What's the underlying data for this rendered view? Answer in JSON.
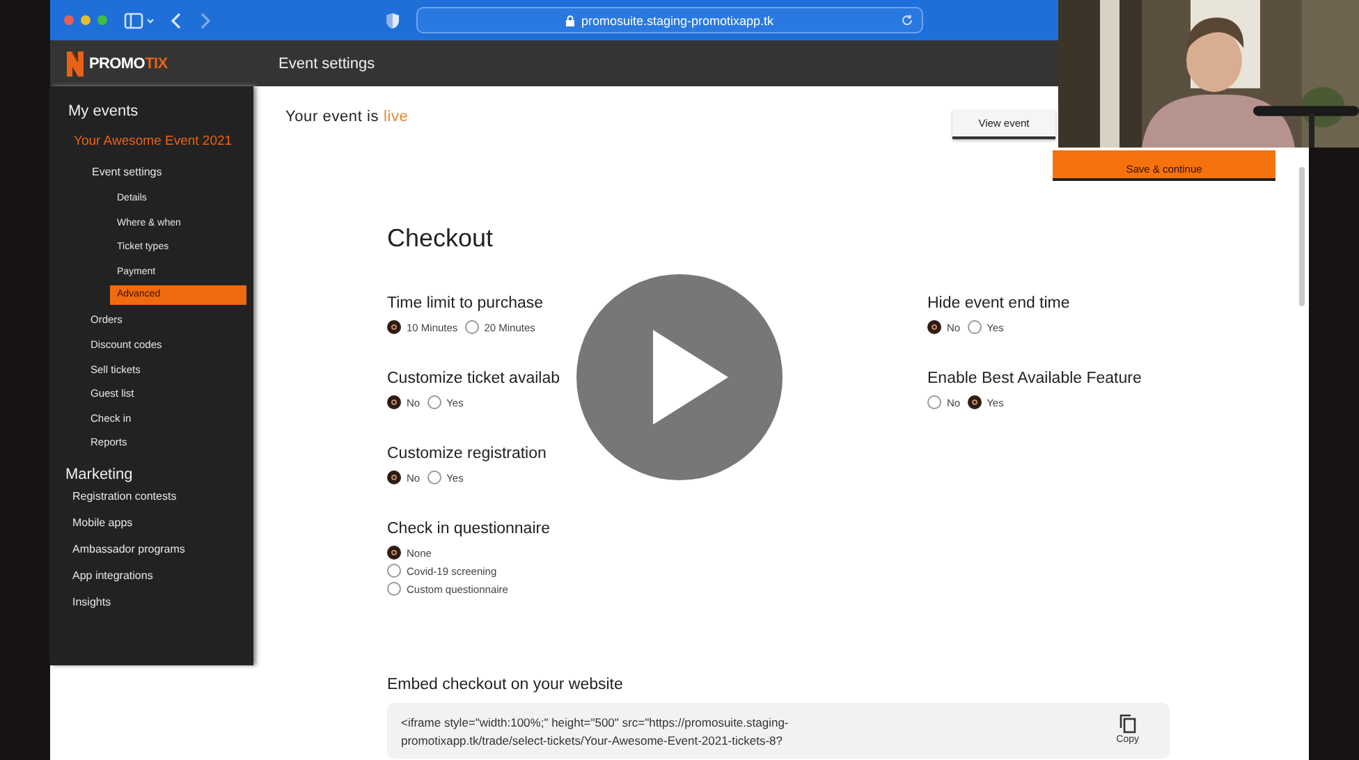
{
  "browser": {
    "url": "promosuite.staging-promotixapp.tk"
  },
  "app": {
    "logo_left": "PROMO",
    "logo_right": "TIX",
    "title": "Event settings"
  },
  "sidebar": {
    "heading": "My events",
    "event_name": "Your Awesome Event 2021",
    "items": [
      {
        "label": "Event settings",
        "selected": false,
        "children": [
          {
            "label": "Details",
            "selected": false
          },
          {
            "label": "Where & when",
            "selected": false
          },
          {
            "label": "Ticket types",
            "selected": false
          },
          {
            "label": "Payment",
            "selected": false
          },
          {
            "label": "Advanced",
            "selected": true
          }
        ]
      },
      {
        "label": "Orders",
        "selected": false
      },
      {
        "label": "Discount codes",
        "selected": false
      },
      {
        "label": "Sell tickets",
        "selected": false
      },
      {
        "label": "Guest list",
        "selected": false
      },
      {
        "label": "Check in",
        "selected": false
      },
      {
        "label": "Reports",
        "selected": false
      }
    ],
    "marketing_heading": "Marketing",
    "marketing_items": [
      {
        "label": "Registration contests",
        "selected": false
      },
      {
        "label": "Mobile apps",
        "selected": false
      },
      {
        "label": "Ambassador programs",
        "selected": false
      },
      {
        "label": "App integrations",
        "selected": false
      },
      {
        "label": "Insights",
        "selected": false
      }
    ]
  },
  "status": {
    "prefix": "Your event is",
    "state": "live"
  },
  "buttons": {
    "view": "View event",
    "save": "Save & continue"
  },
  "section_title": "Checkout",
  "settings_left": [
    {
      "label": "Time limit to purchase",
      "kind": "inline",
      "options": [
        {
          "label": "10 Minutes",
          "selected": true
        },
        {
          "label": "20 Minutes",
          "selected": false
        }
      ]
    },
    {
      "label": "Customize ticket availab",
      "kind": "inline",
      "options": [
        {
          "label": "No",
          "selected": true
        },
        {
          "label": "Yes",
          "selected": false
        }
      ]
    },
    {
      "label": "Customize registration",
      "kind": "inline",
      "options": [
        {
          "label": "No",
          "selected": true
        },
        {
          "label": "Yes",
          "selected": false
        }
      ]
    },
    {
      "label": "Check in questionnaire",
      "kind": "stacked",
      "options": [
        {
          "label": "None",
          "selected": true
        },
        {
          "label": "Covid-19 screening",
          "selected": false
        },
        {
          "label": "Custom questionnaire",
          "selected": false
        }
      ]
    }
  ],
  "settings_right": [
    {
      "label": "Hide event end time",
      "kind": "inline",
      "options": [
        {
          "label": "No",
          "selected": true
        },
        {
          "label": "Yes",
          "selected": false
        }
      ]
    },
    {
      "label": "Enable Best Available Feature",
      "kind": "inline",
      "options": [
        {
          "label": "No",
          "selected": false
        },
        {
          "label": "Yes",
          "selected": true
        }
      ]
    }
  ],
  "embed": {
    "title": "Embed checkout on your website",
    "code": "<iframe style=\"width:100%;\" height=\"500\" src=\"https://promosuite.staging-promotixapp.tk/trade/select-tickets/Your-Awesome-Event-2021-tickets-8?",
    "copy": "Copy"
  }
}
